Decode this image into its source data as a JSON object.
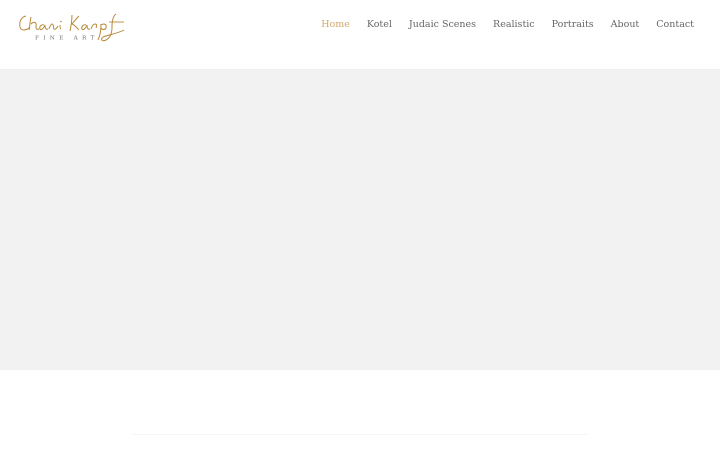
{
  "brand": {
    "name": "Chani Karp",
    "tagline": "FINE ART",
    "logo_color": "#b88a3a"
  },
  "nav": {
    "items": [
      {
        "label": "Home",
        "active": true
      },
      {
        "label": "Kotel",
        "active": false
      },
      {
        "label": "Judaic Scenes",
        "active": false
      },
      {
        "label": "Realistic",
        "active": false
      },
      {
        "label": "Portraits",
        "active": false
      },
      {
        "label": "About",
        "active": false
      },
      {
        "label": "Contact",
        "active": false
      }
    ],
    "active_color": "#d1a96b",
    "text_color": "#676767"
  },
  "hero": {
    "background": "#f2f2f2"
  }
}
